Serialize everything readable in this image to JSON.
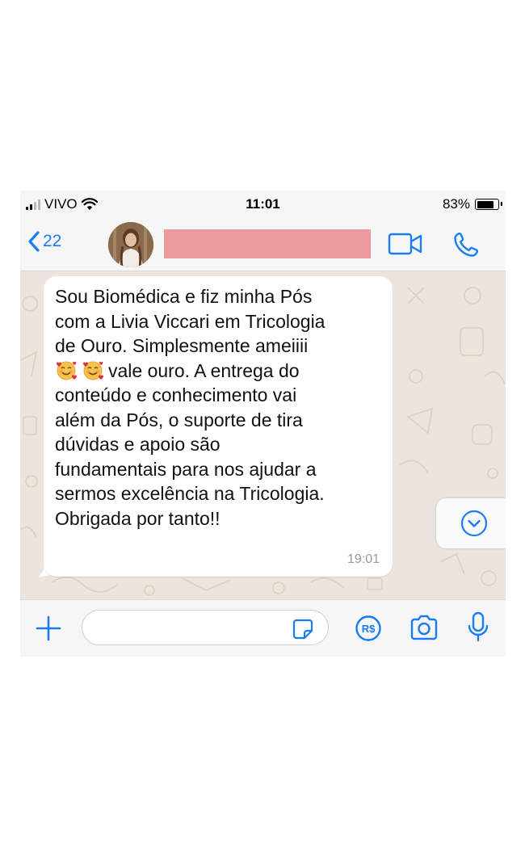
{
  "status_bar": {
    "carrier": "VIVO",
    "time": "11:01",
    "battery_percent": "83%",
    "battery_level": 0.83
  },
  "header": {
    "back_count": "22",
    "contact_name": "",
    "icons": [
      "chevron-left-icon",
      "video-call-icon",
      "phone-icon"
    ]
  },
  "chat": {
    "messages": [
      {
        "direction": "incoming",
        "lines": [
          "Sou Biomédica e fiz minha Pós",
          "com a Livia Viccari em Tricologia",
          "de Ouro. Simplesmente ameiiii",
          "vale ouro. A entrega do",
          "conteúdo e conhecimento vai",
          "além da Pós, o suporte de tira",
          "dúvidas e apoio são",
          "fundamentais para nos ajudar a",
          "sermos excelência na Tricologia.",
          "Obrigada por tanto!!"
        ],
        "emojis": [
          "smiling-face-with-hearts",
          "smiling-face-with-hearts"
        ],
        "time": "19:01"
      }
    ]
  },
  "input_bar": {
    "message_value": "",
    "placeholder": "",
    "payment_label": "R$",
    "icons": [
      "plus-icon",
      "sticker-icon",
      "payment-icon",
      "camera-icon",
      "microphone-icon"
    ]
  },
  "colors": {
    "accent": "#1a7cf5",
    "chat_background": "#ece5dd",
    "bubble": "#ffffff",
    "redaction": "#ec9a9e"
  }
}
